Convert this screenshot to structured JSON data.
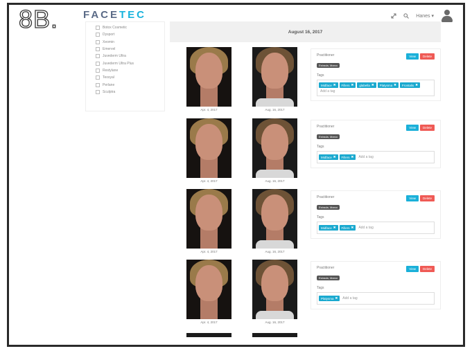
{
  "figure_label": "8B.",
  "app": {
    "logo_a": "FACE",
    "logo_b": "TEC"
  },
  "topbar": {
    "expand_icon": "expand-icon",
    "search_icon": "search-icon",
    "user_name": "Hanes",
    "caret": "▾"
  },
  "sidebar": {
    "items": [
      {
        "label": "Botox Cosmetic"
      },
      {
        "label": "Dysport"
      },
      {
        "label": "Xeomin"
      },
      {
        "label": "Emervel"
      },
      {
        "label": "Juvederm Ultra"
      },
      {
        "label": "Juvederm Ultra Plus"
      },
      {
        "label": "Restylane"
      },
      {
        "label": "Teosyal"
      },
      {
        "label": "Perlane"
      },
      {
        "label": "Sculptra"
      }
    ]
  },
  "main": {
    "date_header": "August 16, 2017",
    "entries": [
      {
        "before_caption": "Apr. 4, 2017",
        "after_caption": "Aug. 16, 2017",
        "practitioner_label": "Practitioner",
        "practitioner": "Estrada, Marco",
        "tags_label": "Tags",
        "view_label": "View",
        "delete_label": "Delete",
        "tags": [
          "Midface",
          "Fillers",
          "glabella",
          "Platysma",
          "Frontalis"
        ],
        "add_tag_placeholder": "Add a tag"
      },
      {
        "before_caption": "Apr. 4, 2017",
        "after_caption": "Aug. 16, 2017",
        "practitioner_label": "Practitioner",
        "practitioner": "Estrada, Marco",
        "tags_label": "Tags",
        "view_label": "View",
        "delete_label": "Delete",
        "tags": [
          "Midface",
          "Fillers"
        ],
        "add_tag_placeholder": "Add a tag"
      },
      {
        "before_caption": "Apr. 4, 2017",
        "after_caption": "Aug. 16, 2017",
        "practitioner_label": "Practitioner",
        "practitioner": "Estrada, Marco",
        "tags_label": "Tags",
        "view_label": "View",
        "delete_label": "Delete",
        "tags": [
          "Midface",
          "Fillers"
        ],
        "add_tag_placeholder": "Add a tag"
      },
      {
        "before_caption": "Apr. 4, 2017",
        "after_caption": "Aug. 16, 2017",
        "practitioner_label": "Practitioner",
        "practitioner": "Estrada, Marco",
        "tags_label": "Tags",
        "view_label": "View",
        "delete_label": "Delete",
        "tags": [
          "Platysma"
        ],
        "add_tag_placeholder": "Add a tag"
      }
    ]
  },
  "colors": {
    "accent": "#1ab0d9",
    "danger": "#ef5a55",
    "badge": "#555555"
  }
}
